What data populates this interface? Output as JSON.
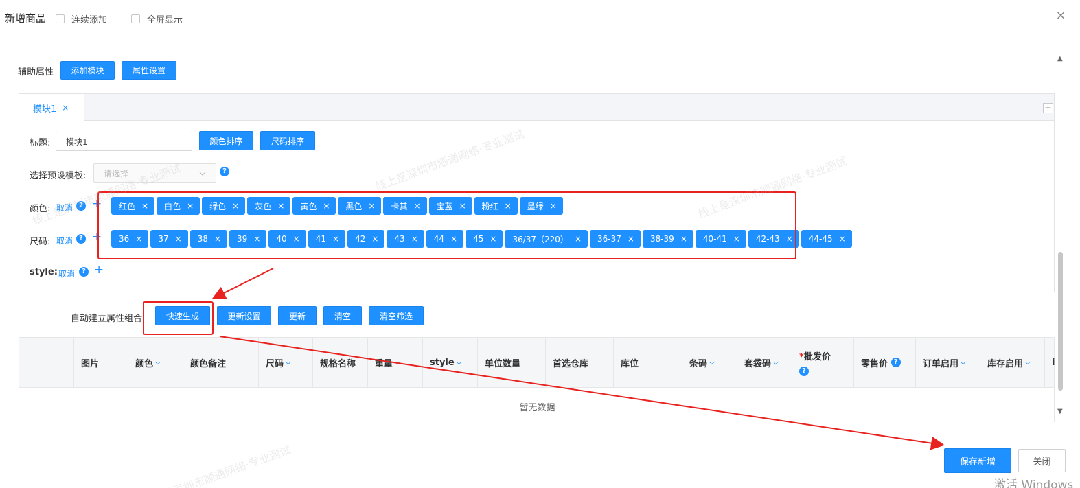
{
  "header": {
    "title": "新增商品",
    "continuous_add": "连续添加",
    "fullscreen": "全屏显示",
    "close": "×"
  },
  "aux": {
    "label": "辅助属性",
    "add_module": "添加模块",
    "attr_settings": "属性设置"
  },
  "module": {
    "tab_label": "模块1",
    "tab_close": "×",
    "tab_add": "+",
    "title_label": "标题:",
    "title_value": "模块1",
    "color_sort": "颜色排序",
    "size_sort": "尺码排序",
    "template_label": "选择预设模板:",
    "template_placeholder": "请选择",
    "color_label": "颜色:",
    "size_label": "尺码:",
    "style_label": "style:",
    "cancel": "取消",
    "colors": [
      "红色",
      "白色",
      "绿色",
      "灰色",
      "黄色",
      "黑色",
      "卡其",
      "宝蓝",
      "粉红",
      "墨绿"
    ],
    "sizes": [
      "36",
      "37",
      "38",
      "39",
      "40",
      "41",
      "42",
      "43",
      "44",
      "45",
      "36/37（220）",
      "36-37",
      "38-39",
      "40-41",
      "42-43",
      "44-45"
    ]
  },
  "combo": {
    "label": "自动建立属性组合",
    "quick_generate": "快速生成",
    "update_settings": "更新设置",
    "update": "更新",
    "clear": "清空",
    "clear_filter": "清空筛选"
  },
  "table": {
    "columns": [
      "图片",
      "颜色",
      "颜色备注",
      "尺码",
      "规格名称",
      "重量",
      "style",
      "单位数量",
      "首选仓库",
      "库位",
      "条码",
      "套袋码",
      "批发价",
      "零售价",
      "订单启用",
      "库存启用",
      "i"
    ],
    "required_mark": "*",
    "empty_text": "暂无数据"
  },
  "footer": {
    "save_new": "保存新增",
    "close": "关闭"
  },
  "watermark": {
    "text": "线上是深圳市顺通网络·专业测试"
  },
  "os": {
    "activate": "激活 Windows"
  }
}
